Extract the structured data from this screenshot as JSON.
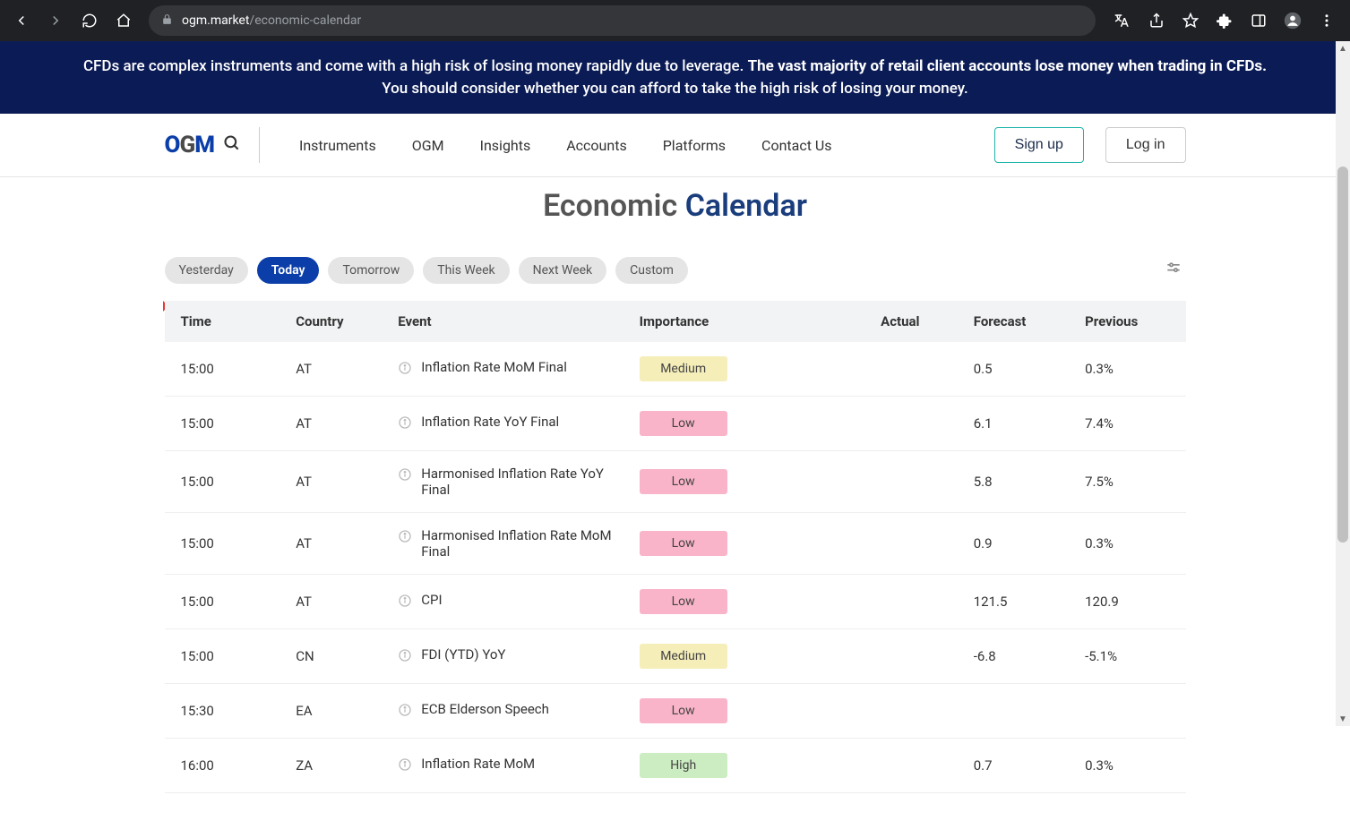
{
  "browser": {
    "url_domain": "ogm.market",
    "url_path": "/economic-calendar"
  },
  "banner": {
    "line1_a": "CFDs are complex instruments and come with a high risk of losing money rapidly due to leverage. ",
    "line1_b": "The vast majority of retail client accounts lose money when trading in CFDs.",
    "line2": "You should consider whether you can afford to take the high risk of losing your money."
  },
  "header": {
    "logo": "OGM",
    "nav": [
      "Instruments",
      "OGM",
      "Insights",
      "Accounts",
      "Platforms",
      "Contact Us"
    ],
    "signup": "Sign up",
    "login": "Log in"
  },
  "page": {
    "title_a": "Economic ",
    "title_b": "Calendar"
  },
  "filters": {
    "tabs": [
      "Yesterday",
      "Today",
      "Tomorrow",
      "This Week",
      "Next Week",
      "Custom"
    ],
    "active_index": 1
  },
  "table": {
    "headers": [
      "Time",
      "Country",
      "Event",
      "Importance",
      "Actual",
      "Forecast",
      "Previous"
    ],
    "rows": [
      {
        "time": "15:00",
        "country": "AT",
        "event": "Inflation Rate MoM Final",
        "importance": "Medium",
        "actual": "",
        "forecast": "0.5",
        "previous": "0.3%"
      },
      {
        "time": "15:00",
        "country": "AT",
        "event": "Inflation Rate YoY Final",
        "importance": "Low",
        "actual": "",
        "forecast": "6.1",
        "previous": "7.4%"
      },
      {
        "time": "15:00",
        "country": "AT",
        "event": "Harmonised Inflation Rate YoY Final",
        "importance": "Low",
        "actual": "",
        "forecast": "5.8",
        "previous": "7.5%"
      },
      {
        "time": "15:00",
        "country": "AT",
        "event": "Harmonised Inflation Rate MoM Final",
        "importance": "Low",
        "actual": "",
        "forecast": "0.9",
        "previous": "0.3%"
      },
      {
        "time": "15:00",
        "country": "AT",
        "event": "CPI",
        "importance": "Low",
        "actual": "",
        "forecast": "121.5",
        "previous": "120.9"
      },
      {
        "time": "15:00",
        "country": "CN",
        "event": "FDI (YTD) YoY",
        "importance": "Medium",
        "actual": "",
        "forecast": "-6.8",
        "previous": "-5.1%"
      },
      {
        "time": "15:30",
        "country": "EA",
        "event": "ECB Elderson Speech",
        "importance": "Low",
        "actual": "",
        "forecast": "",
        "previous": ""
      },
      {
        "time": "16:00",
        "country": "ZA",
        "event": "Inflation Rate MoM",
        "importance": "High",
        "actual": "",
        "forecast": "0.7",
        "previous": "0.3%"
      }
    ]
  }
}
